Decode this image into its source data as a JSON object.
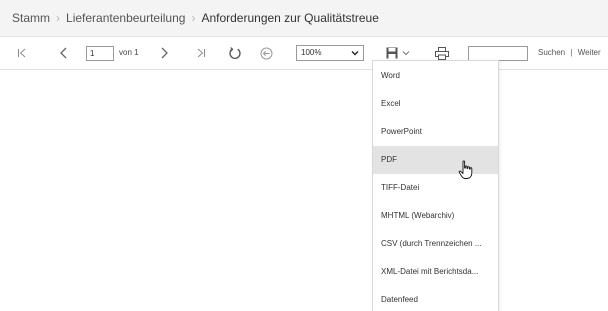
{
  "breadcrumb": {
    "items": [
      "Stamm",
      "Lieferantenbeurteilung",
      "Anforderungen zur Qualitätstreue"
    ]
  },
  "toolbar": {
    "page_input_value": "1",
    "of_label": "von 1",
    "zoom_value": "100%",
    "search_label": "Suchen",
    "separator": "|",
    "next_label": "Weiter"
  },
  "export_menu": {
    "items": [
      "Word",
      "Excel",
      "PowerPoint",
      "PDF",
      "TIFF-Datei",
      "MHTML (Webarchiv)",
      "CSV (durch Trennzeichen ...",
      "XML-Datei mit Berichtsda...",
      "Datenfeed"
    ],
    "hovered_item": "PDF"
  },
  "icons": {
    "first_page": "first-page-icon",
    "prev_page": "prev-page-icon",
    "next_page": "next-page-icon",
    "last_page": "last-page-icon",
    "refresh": "refresh-icon",
    "back": "back-icon",
    "export": "save-disk-icon",
    "print": "printer-icon",
    "cursor": "hand-pointer-icon"
  },
  "colors": {
    "breadcrumb_bg": "#f4f4f4",
    "menu_hover": "#e3e3e3",
    "icon_gray": "#777777"
  }
}
